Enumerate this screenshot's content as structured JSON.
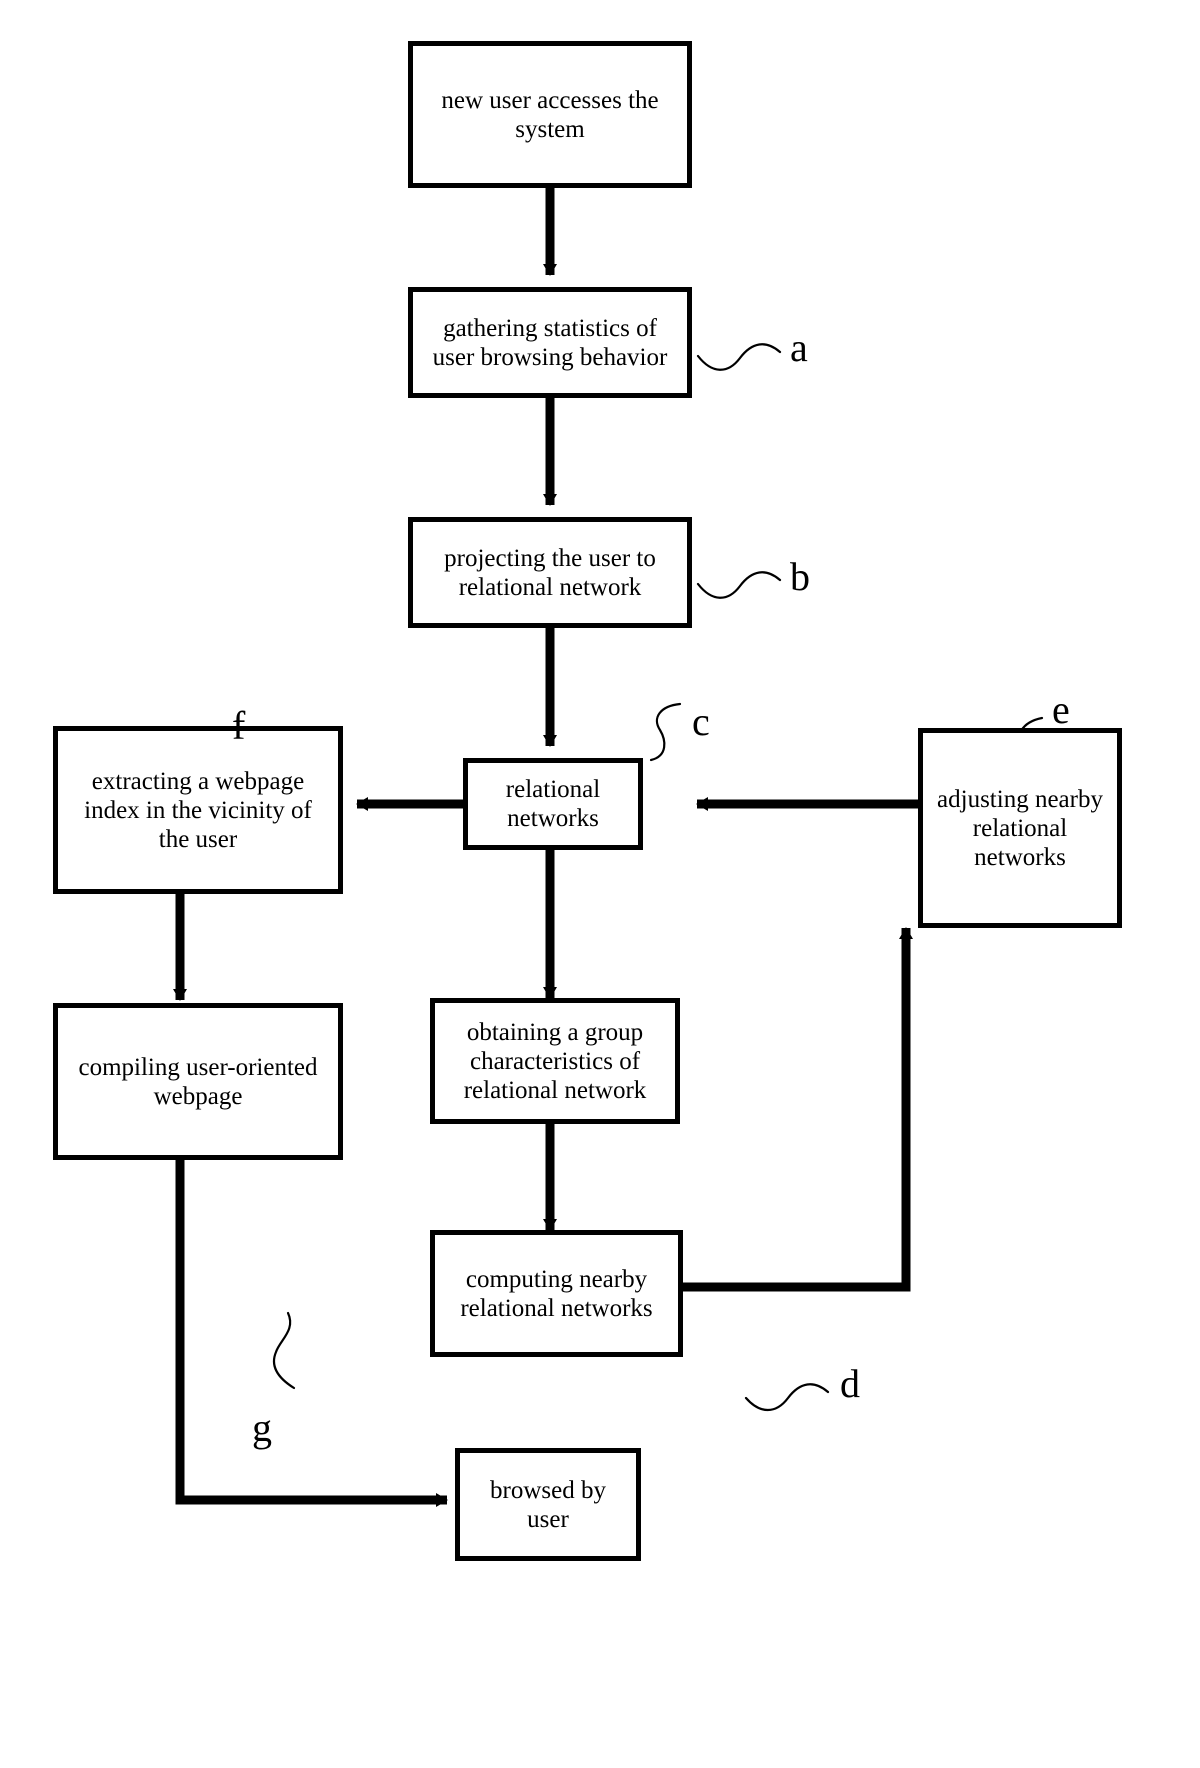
{
  "diagram": {
    "title": "user-oriented webpage recommendation flowchart",
    "background_color": "#ffffff",
    "line_color": "#000000",
    "nodes": [
      {
        "id": "n1",
        "label": "new user accesses the system"
      },
      {
        "id": "n2",
        "label": "gathering statistics of user browsing behavior"
      },
      {
        "id": "n3",
        "label": "projecting the user to relational network"
      },
      {
        "id": "n4",
        "label": "relational networks"
      },
      {
        "id": "n5",
        "label": "extracting a webpage index in the vicinity of the user"
      },
      {
        "id": "n6",
        "label": "adjusting nearby relational networks"
      },
      {
        "id": "n7",
        "label": "compiling user-oriented webpage"
      },
      {
        "id": "n8",
        "label": "obtaining a group characteristics of relational network"
      },
      {
        "id": "n9",
        "label": "computing nearby relational networks"
      },
      {
        "id": "n10",
        "label": "browsed by user"
      }
    ],
    "reference_labels": [
      {
        "id": "ra",
        "text": "a",
        "points_to": "n2"
      },
      {
        "id": "rb",
        "text": "b",
        "points_to": "n3"
      },
      {
        "id": "rc",
        "text": "c",
        "points_to": "n4"
      },
      {
        "id": "rd",
        "text": "d",
        "points_to": "n9"
      },
      {
        "id": "re",
        "text": "e",
        "points_to": "n6"
      },
      {
        "id": "rf",
        "text": "f",
        "points_to": "n5"
      },
      {
        "id": "rg",
        "text": "g",
        "points_to": "n7"
      }
    ],
    "edges": [
      {
        "from": "n1",
        "to": "n2",
        "kind": "arrow-down"
      },
      {
        "from": "n2",
        "to": "n3",
        "kind": "arrow-down"
      },
      {
        "from": "n3",
        "to": "n4",
        "kind": "arrow-down"
      },
      {
        "from": "n4",
        "to": "n5",
        "kind": "arrow-left"
      },
      {
        "from": "n6",
        "to": "n4",
        "kind": "arrow-left"
      },
      {
        "from": "n4",
        "to": "n8",
        "kind": "arrow-down"
      },
      {
        "from": "n5",
        "to": "n7",
        "kind": "arrow-down"
      },
      {
        "from": "n8",
        "to": "n9",
        "kind": "arrow-down"
      },
      {
        "from": "n9",
        "to": "n6",
        "kind": "arrow-elbow-up"
      },
      {
        "from": "n7",
        "to": "n10",
        "kind": "arrow-elbow-right"
      }
    ]
  }
}
